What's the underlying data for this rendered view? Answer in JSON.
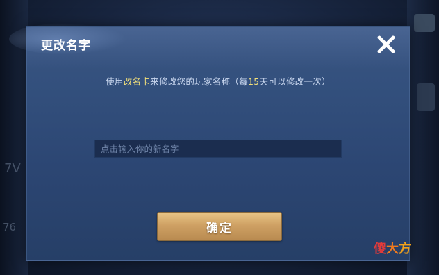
{
  "background": {
    "left_text_1": "7V",
    "left_text_2": "76"
  },
  "dialog": {
    "title": "更改名字",
    "subtitle_part1": "使用",
    "subtitle_highlight1": "改名卡",
    "subtitle_part2": "来修改您的玩家名称（每",
    "subtitle_highlight2": "15",
    "subtitle_part3": "天可以修改一次）",
    "input_placeholder": "点击输入你的新名字",
    "input_value": "",
    "confirm_label": "确定",
    "close_icon": "close-icon"
  },
  "watermark": {
    "char1": "傻",
    "char2": "大",
    "char3": "方"
  },
  "colors": {
    "accent_highlight": "#f3e07a",
    "dialog_bg": "#2e4a78",
    "button_gold": "#cfa164"
  }
}
